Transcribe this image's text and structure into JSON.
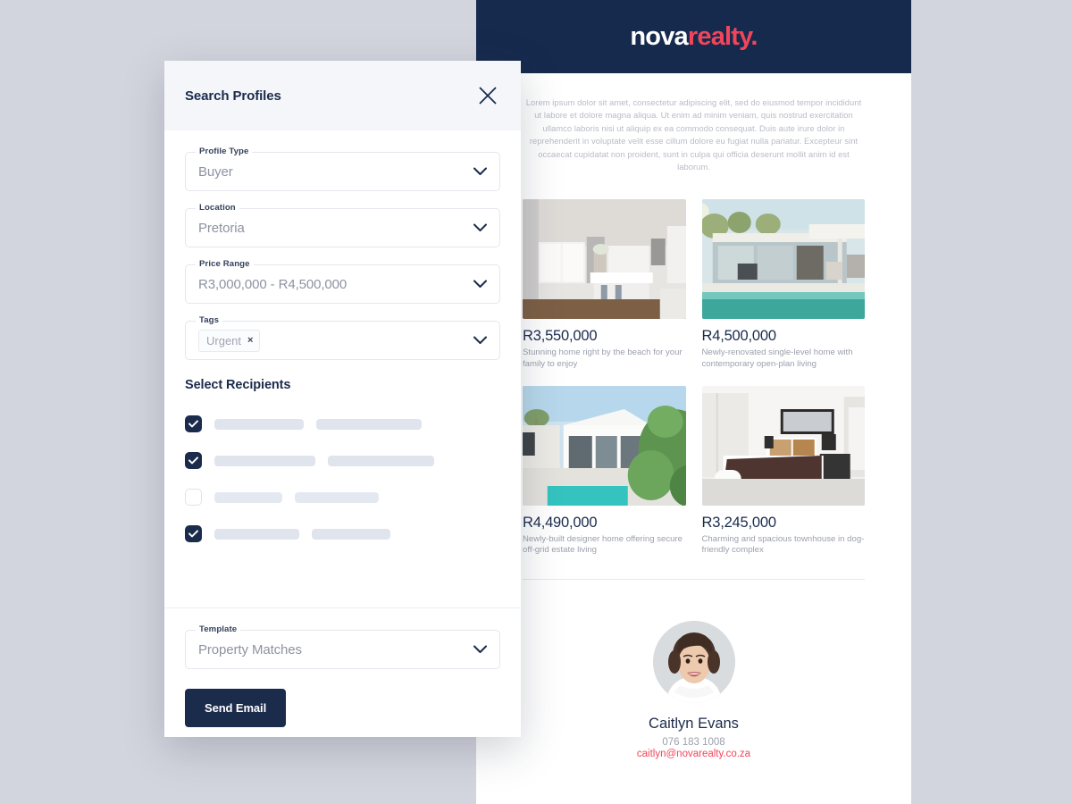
{
  "modal": {
    "title": "Search Profiles",
    "close_icon": "close-icon",
    "fields": [
      {
        "label": "Profile Type",
        "value": "Buyer"
      },
      {
        "label": "Location",
        "value": "Pretoria"
      },
      {
        "label": "Price Range",
        "value": "R3,000,000 - R4,500,000"
      }
    ],
    "tags_field": {
      "label": "Tags",
      "chips": [
        {
          "label": "Urgent",
          "remove_icon": "×"
        }
      ]
    },
    "recipients": {
      "title": "Select Recipients",
      "rows": [
        {
          "checked": true,
          "bar1": 100,
          "bar2": 118
        },
        {
          "checked": true,
          "bar1": 113,
          "bar2": 119
        },
        {
          "checked": false,
          "bar1": 76,
          "bar2": 94
        },
        {
          "checked": true,
          "bar1": 95,
          "bar2": 88
        }
      ]
    },
    "template_field": {
      "label": "Template",
      "value": "Property Matches"
    },
    "send_label": "Send Email",
    "accent_navy": "#1b2b4b"
  },
  "email": {
    "logo": {
      "part1": "nova",
      "part2": "realty.",
      "color1": "#ffffff",
      "color2": "#f3455a"
    },
    "header_bg": "#162a4e",
    "lorem": "Lorem ipsum dolor sit amet, consectetur adipiscing elit, sed do eiusmod tempor incididunt ut labore et dolore magna aliqua. Ut enim ad minim veniam, quis nostrud exercitation ullamco laboris nisi ut aliquip ex ea commodo consequat. Duis aute irure dolor in reprehenderit in voluptate velit esse cillum dolore eu fugiat nulla pariatur. Excepteur sint occaecat cupidatat non proident, sunt in culpa qui officia deserunt mollit anim id est laborum.",
    "properties": [
      {
        "price": "R3,550,000",
        "desc": "Stunning home right by the beach for your family to enjoy",
        "image": "kitchen-interior"
      },
      {
        "price": "R4,500,000",
        "desc": "Newly-renovated single-level home with contemporary open-plan living",
        "image": "modern-house-pool"
      },
      {
        "price": "R4,490,000",
        "desc": "Newly-built designer home offering secure off-grid estate living",
        "image": "white-villa-pool"
      },
      {
        "price": "R3,245,000",
        "desc": "Charming and spacious townhouse in dog-friendly complex",
        "image": "bedroom-interior"
      }
    ],
    "agent": {
      "name": "Caitlyn Evans",
      "phone": "076 183 1008",
      "email": "caitlyn@novarealty.co.za",
      "email_color": "#f3455a"
    }
  }
}
